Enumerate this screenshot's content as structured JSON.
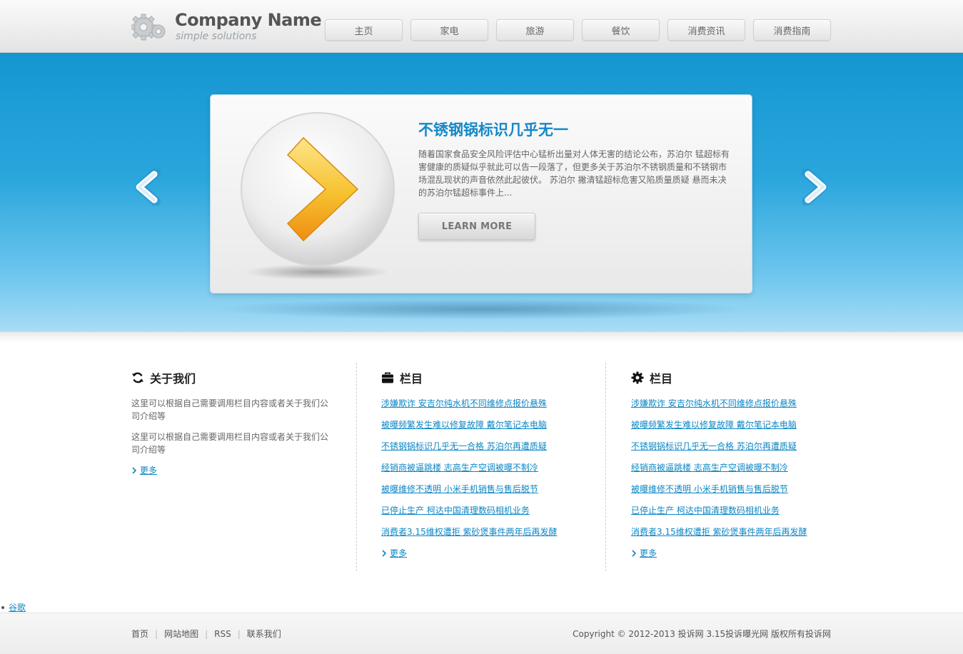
{
  "brand": {
    "name": "Company Name",
    "tagline": "simple solutions"
  },
  "nav": [
    {
      "label": "主页"
    },
    {
      "label": "家电"
    },
    {
      "label": "旅游"
    },
    {
      "label": "餐饮"
    },
    {
      "label": "消费资讯"
    },
    {
      "label": "消费指南"
    }
  ],
  "slider": {
    "title": "不锈钢锅标识几乎无一",
    "text": "随着国家食品安全风险评估中心锰析出量对人体无害的结论公布，苏泊尔 锰超标有害健康的质疑似乎就此可以告一段落了，但更多关于苏泊尔不锈钢质量和不锈钢市场混乱现状的声音依然此起彼伏。 苏泊尔 撇清锰超标危害又陷质量质疑 悬而未决的苏泊尔锰超标事件上...",
    "button": "LEARN MORE",
    "prev_icon": "chevron-left-icon",
    "next_icon": "chevron-right-icon"
  },
  "about": {
    "title": "关于我们",
    "icon": "refresh-icon",
    "paragraphs": [
      "这里可以根据自己需要调用栏目内容或者关于我们公司介绍等",
      "这里可以根据自己需要调用栏目内容或者关于我们公司介绍等"
    ],
    "more": "更多"
  },
  "col2": {
    "title": "栏目",
    "icon": "briefcase-icon",
    "links": [
      "涉嫌欺诈 安吉尔纯水机不同维修点报价悬殊",
      "被曝频繁发生难以修复故障 戴尔笔记本电脑",
      "不锈钢锅标识几乎无一合格 苏泊尔再遭质疑",
      "经销商被逼跳楼 志高生产空调被曝不制冷",
      "被曝维修不透明 小米手机销售与售后脱节",
      "已停止生产 柯达中国清理数码相机业务",
      "消费者3.15维权遭拒 紫砂煲事件两年后再发酵"
    ],
    "more": "更多"
  },
  "col3": {
    "title": "栏目",
    "icon": "gear-icon",
    "links": [
      "涉嫌欺诈 安吉尔纯水机不同维修点报价悬殊",
      "被曝频繁发生难以修复故障 戴尔笔记本电脑",
      "不锈钢锅标识几乎无一合格 苏泊尔再遭质疑",
      "经销商被逼跳楼 志高生产空调被曝不制冷",
      "被曝维修不透明 小米手机销售与售后脱节",
      "已停止生产 柯达中国清理数码相机业务",
      "消费者3.15维权遭拒 紫砂煲事件两年后再发酵"
    ],
    "more": "更多"
  },
  "stray_link": "谷歌",
  "footer": {
    "links": [
      "首页",
      "网站地图",
      "RSS",
      "联系我们"
    ],
    "copyright": "Copyright © 2012-2013 投诉网 3.15投诉曝光网 版权所有投诉网"
  },
  "colors": {
    "accent": "#1588c8",
    "link": "#0c86c4",
    "banner_top": "#1596d1",
    "banner_bottom": "#a8dcf5"
  }
}
